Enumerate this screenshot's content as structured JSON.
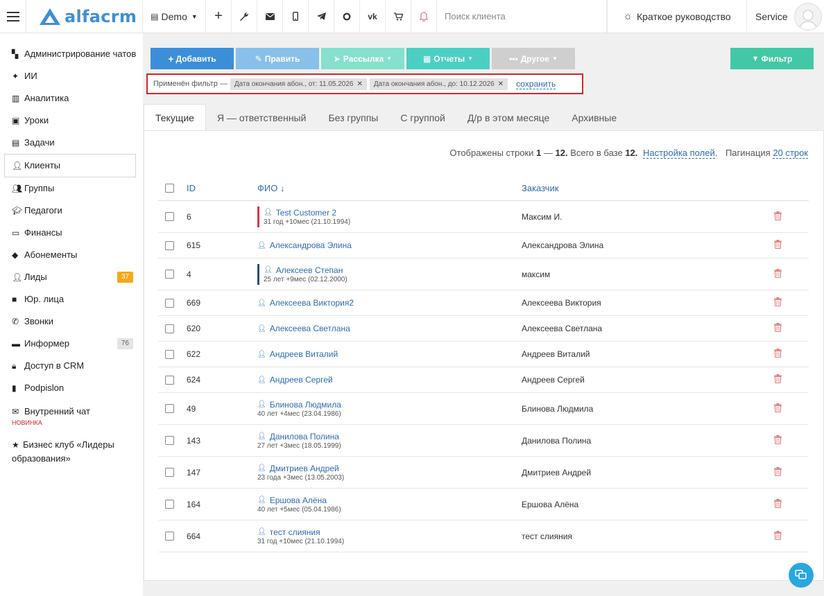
{
  "header": {
    "logo": "alfacrm",
    "branch": "Demo",
    "search_placeholder": "Поиск клиента",
    "guide": "Краткое руководство",
    "user": "Service",
    "icons": [
      "plus-icon",
      "wrench-icon",
      "mail-icon",
      "phone-icon",
      "telegram-icon",
      "circle-icon",
      "vk-icon",
      "cart-icon",
      "bell-icon"
    ]
  },
  "sidebar": {
    "items": [
      {
        "label": "Администрирование чатов",
        "icon": "chats-icon"
      },
      {
        "label": "ИИ",
        "icon": "sparkle-icon"
      },
      {
        "label": "Аналитика",
        "icon": "map-icon"
      },
      {
        "label": "Уроки",
        "icon": "calendar-icon"
      },
      {
        "label": "Задачи",
        "icon": "tasks-icon"
      },
      {
        "label": "Клиенты",
        "icon": "user-icon"
      },
      {
        "label": "Группы",
        "icon": "users-icon"
      },
      {
        "label": "Педагоги",
        "icon": "graduation-icon"
      },
      {
        "label": "Финансы",
        "icon": "money-icon"
      },
      {
        "label": "Абонементы",
        "icon": "tag-icon"
      },
      {
        "label": "Лиды",
        "icon": "user-plus-icon",
        "badge": "37"
      },
      {
        "label": "Юр. лица",
        "icon": "briefcase-icon"
      },
      {
        "label": "Звонки",
        "icon": "phone-icon"
      },
      {
        "label": "Информер",
        "icon": "inbox-icon",
        "badge": "76"
      },
      {
        "label": "Доступ в CRM",
        "icon": "lock-icon"
      },
      {
        "label": "Podpislon",
        "icon": "file-icon"
      },
      {
        "label": "Внутренний чат",
        "icon": "envelope-icon",
        "note": "НОВИНКА"
      },
      {
        "label": "Бизнес клуб «Лидеры образования»",
        "icon": "star-icon"
      }
    ]
  },
  "toolbar": {
    "add": "Добавить",
    "edit": "Править",
    "mailing": "Рассылка",
    "reports": "Отчеты",
    "other": "Другое",
    "filter": "Фильтр"
  },
  "filter": {
    "prefix": "Применён фильтр —",
    "chips": [
      "Дата окончания абон., от: 11.05.2026",
      "Дата окончания абон., до: 10.12.2026"
    ],
    "save": "сохранить"
  },
  "tabs": [
    "Текущие",
    "Я — ответственный",
    "Без группы",
    "С группой",
    "Д/р в этом месяце",
    "Архивные"
  ],
  "info": {
    "shown_prefix": "Отображены строки",
    "range_from": "1",
    "dash": "—",
    "range_to": "12.",
    "total_prefix": "Всего в базе",
    "total": "12.",
    "fields_link": "Настройка полей",
    "pagination_label": "Пагинация",
    "pagination_value": "20 строк"
  },
  "table": {
    "columns": {
      "id": "ID",
      "fio": "ФИО ↓",
      "customer": "Заказчик"
    },
    "rows": [
      {
        "id": "6",
        "name": "Test Customer 2",
        "age": "31 год +10мес (21.10.1994)",
        "customer": "Максим И.",
        "mark": "#d9344a"
      },
      {
        "id": "615",
        "name": "Александрова Элина",
        "age": "",
        "customer": "Александрова Элина",
        "mark": ""
      },
      {
        "id": "4",
        "name": "Алексеев Степан",
        "age": "25 лет +9мес (02.12.2000)",
        "customer": "максим",
        "mark": "#2d4a7a"
      },
      {
        "id": "669",
        "name": "Алексеева Виктория2",
        "age": "",
        "customer": "Алексеева Виктория",
        "mark": ""
      },
      {
        "id": "620",
        "name": "Алексеева Светлана",
        "age": "",
        "customer": "Алексеева Светлана",
        "mark": ""
      },
      {
        "id": "622",
        "name": "Андреев Виталий",
        "age": "",
        "customer": "Андреев Виталий",
        "mark": ""
      },
      {
        "id": "624",
        "name": "Андреев Сергей",
        "age": "",
        "customer": "Андреев Сергей",
        "mark": ""
      },
      {
        "id": "49",
        "name": "Блинова Людмила",
        "age": "40 лет +4мес (23.04.1986)",
        "customer": "Блинова Людмила",
        "mark": ""
      },
      {
        "id": "143",
        "name": "Данилова Полина",
        "age": "27 лет +3мес (18.05.1999)",
        "customer": "Данилова Полина",
        "mark": ""
      },
      {
        "id": "147",
        "name": "Дмитриев Андрей",
        "age": "23 года +3мес (13.05.2003)",
        "customer": "Дмитриев Андрей",
        "mark": ""
      },
      {
        "id": "164",
        "name": "Ершова Алёна",
        "age": "40 лет +5мес (05.04.1986)",
        "customer": "Ершова Алёна",
        "mark": ""
      },
      {
        "id": "664",
        "name": "тест слияния",
        "age": "31 год +10мес (21.10.1994)",
        "customer": "тест слияния",
        "mark": ""
      }
    ]
  }
}
